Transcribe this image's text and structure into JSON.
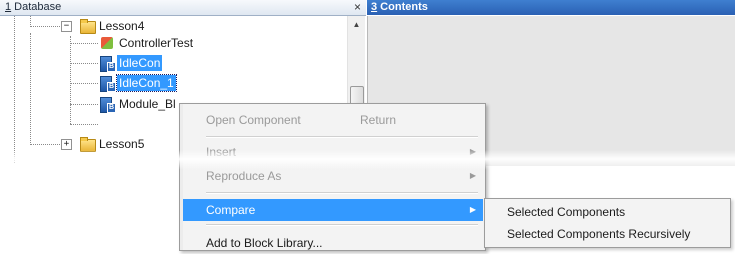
{
  "database_panel": {
    "title_index": "1",
    "title_text": " Database",
    "close_glyph": "×",
    "tree": {
      "folder_lesson4": "Lesson4",
      "item_controller_test": "ControllerTest",
      "item_idlecon": "IdleCon",
      "item_idlecon_1": "IdleCon_1",
      "item_module": "Module_Bl",
      "folder_lesson5": "Lesson5",
      "expand_minus": "−",
      "expand_plus": "+"
    },
    "scroll_up_glyph": "▲"
  },
  "contents_panel": {
    "title_index": "3",
    "title_text": " Contents"
  },
  "context_menu": {
    "open_component": "Open Component",
    "open_component_shortcut": "Return",
    "insert": "Insert",
    "reproduce_as": "Reproduce As",
    "compare": "Compare",
    "add_to_block_library": "Add to Block Library...",
    "submenu_arrow": "▶"
  },
  "compare_submenu": {
    "selected_components": "Selected Components",
    "selected_components_recursively": "Selected Components Recursively"
  },
  "colors": {
    "selection": "#3399ff",
    "contents_header": "#2f6ac0",
    "menu_background": "#f3f3f3"
  }
}
